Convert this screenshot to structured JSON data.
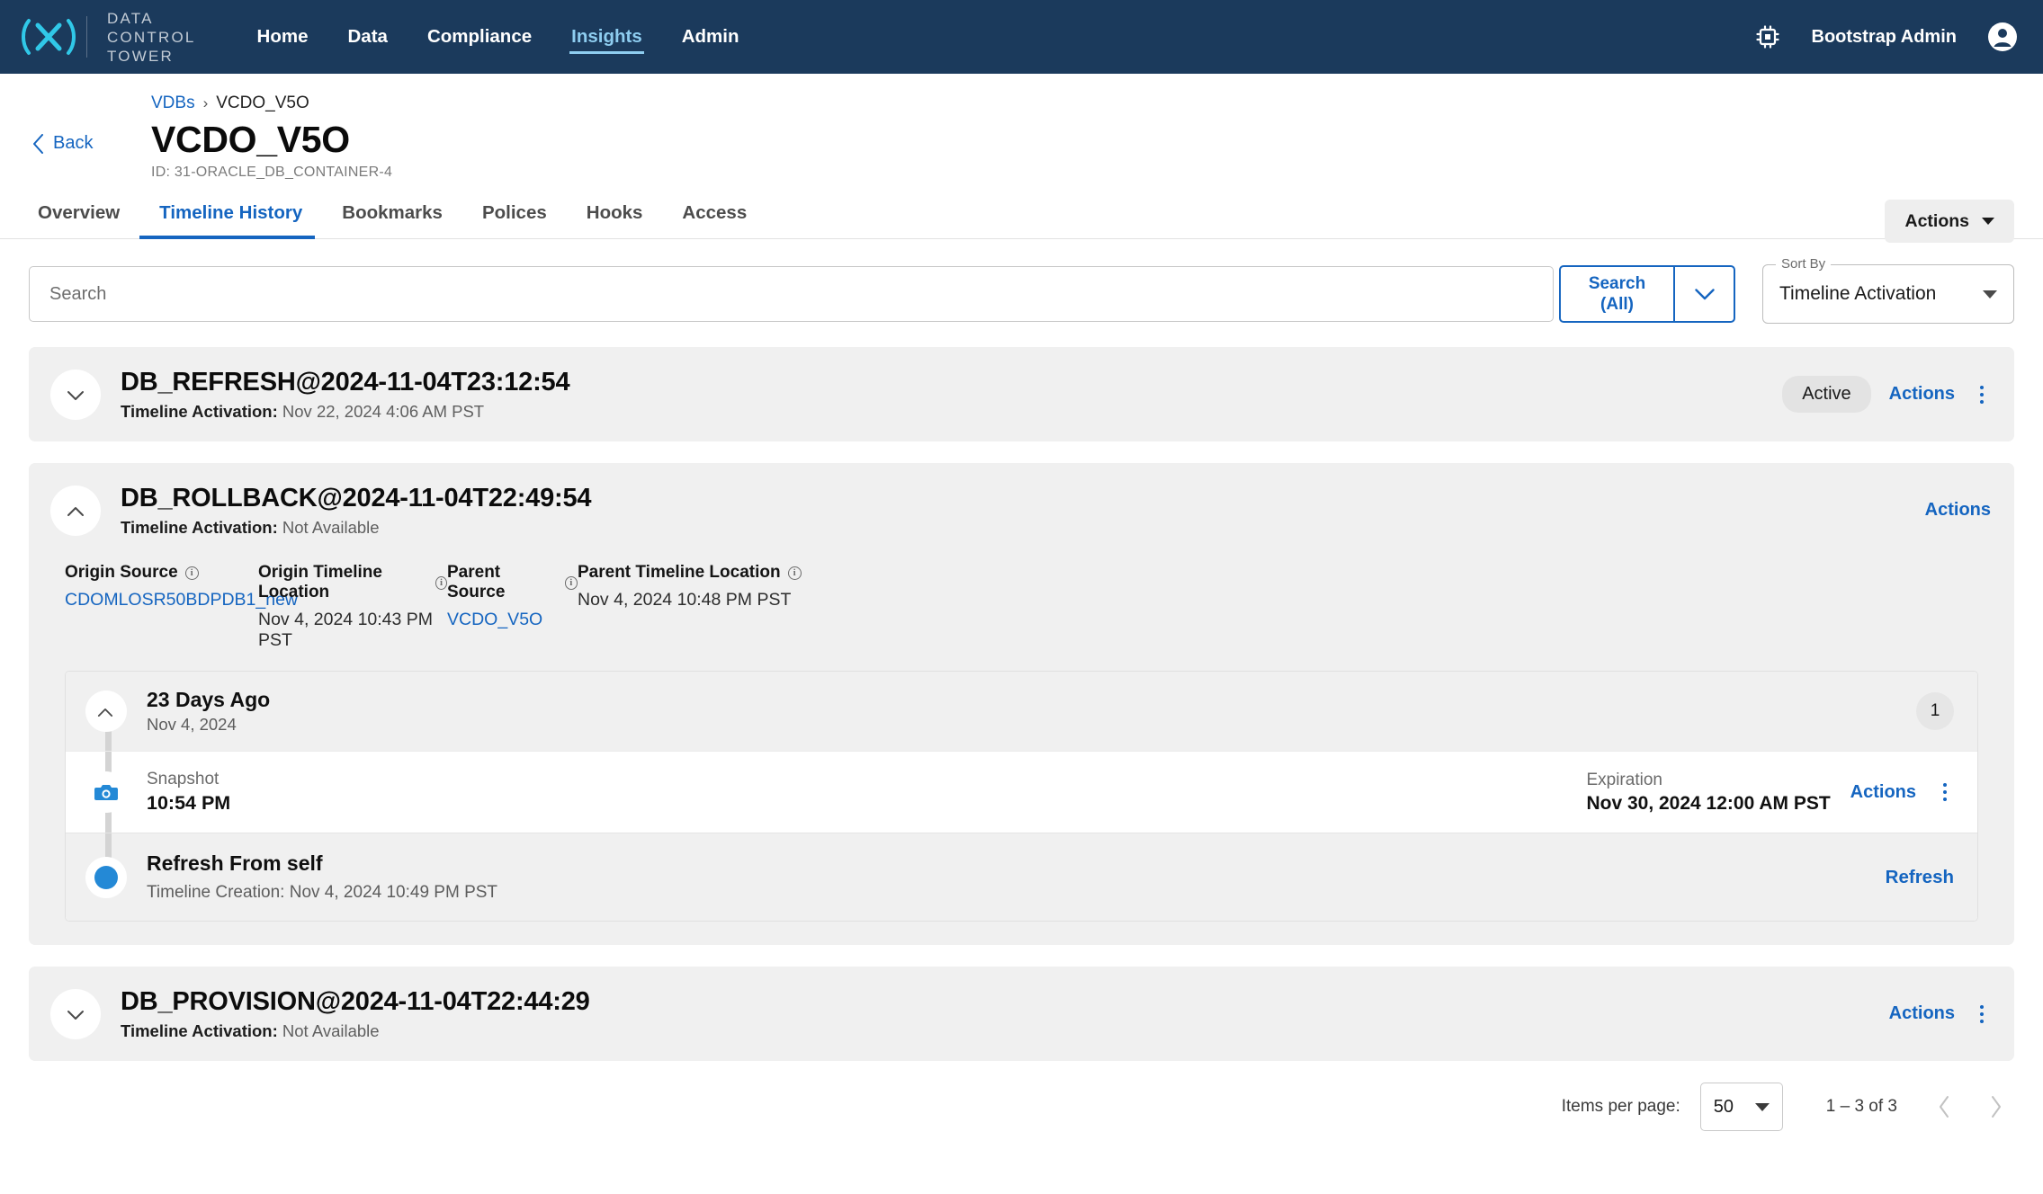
{
  "topnav": {
    "logo_text_lines": [
      "DATA",
      "CONTROL",
      "TOWER"
    ],
    "links": [
      {
        "label": "Home",
        "active": false
      },
      {
        "label": "Data",
        "active": false
      },
      {
        "label": "Compliance",
        "active": false
      },
      {
        "label": "Insights",
        "active": true
      },
      {
        "label": "Admin",
        "active": false
      }
    ],
    "chip_icon": "chip-icon",
    "user_name": "Bootstrap Admin",
    "avatar_icon": "account-circle-icon",
    "bg_color": "#1b3a5c",
    "active_color": "#8ecdf0"
  },
  "header": {
    "back_label": "Back",
    "breadcrumb": {
      "parent": "VDBs",
      "separator": "›",
      "current": "VCDO_V5O"
    },
    "title": "VCDO_V5O",
    "id_text": "ID: 31-ORACLE_DB_CONTAINER-4",
    "actions_label": "Actions"
  },
  "tabs": [
    {
      "label": "Overview",
      "active": false
    },
    {
      "label": "Timeline History",
      "active": true
    },
    {
      "label": "Bookmarks",
      "active": false
    },
    {
      "label": "Polices",
      "active": false
    },
    {
      "label": "Hooks",
      "active": false
    },
    {
      "label": "Access",
      "active": false
    }
  ],
  "search": {
    "placeholder": "Search",
    "value": "",
    "button_line1": "Search",
    "button_line2": "(All)",
    "sort_by_label": "Sort By",
    "sort_by_value": "Timeline Activation"
  },
  "cards": [
    {
      "title": "DB_REFRESH@2024-11-04T23:12:54",
      "sub_label": "Timeline Activation:",
      "sub_value": "Nov 22, 2024 4:06 AM PST",
      "status": "Active",
      "actions_label": "Actions",
      "expanded": false
    },
    {
      "title": "DB_ROLLBACK@2024-11-04T22:49:54",
      "sub_label": "Timeline Activation:",
      "sub_value": "Not Available",
      "actions_label": "Actions",
      "expanded": true,
      "meta": [
        {
          "label": "Origin Source",
          "value": "CDOMLOSR50BDPDB1_new",
          "is_link": true
        },
        {
          "label": "Origin Timeline Location",
          "value": "Nov 4, 2024 10:43 PM PST",
          "is_link": false
        },
        {
          "label": "Parent Source",
          "value": "VCDO_V5O",
          "is_link": true
        },
        {
          "label": "Parent Timeline Location",
          "value": "Nov 4, 2024 10:48 PM PST",
          "is_link": false
        }
      ],
      "group": {
        "title": "23 Days Ago",
        "date": "Nov 4, 2024",
        "count": "1"
      },
      "events": [
        {
          "icon": "camera-icon",
          "kicker": "Snapshot",
          "main": "10:54 PM",
          "exp_label": "Expiration",
          "exp_value": "Nov 30, 2024 12:00 AM PST",
          "actions_label": "Actions"
        },
        {
          "icon": "dot-icon",
          "title": "Refresh From self",
          "subtitle": "Timeline Creation: Nov 4, 2024 10:49 PM PST",
          "link_label": "Refresh"
        }
      ]
    },
    {
      "title": "DB_PROVISION@2024-11-04T22:44:29",
      "sub_label": "Timeline Activation:",
      "sub_value": "Not Available",
      "actions_label": "Actions",
      "expanded": false
    }
  ],
  "paginator": {
    "items_per_page_label": "Items per page:",
    "items_per_page_value": "50",
    "range_label": "1 – 3 of 3",
    "prev_icon": "chevron-left-icon",
    "next_icon": "chevron-right-icon"
  }
}
